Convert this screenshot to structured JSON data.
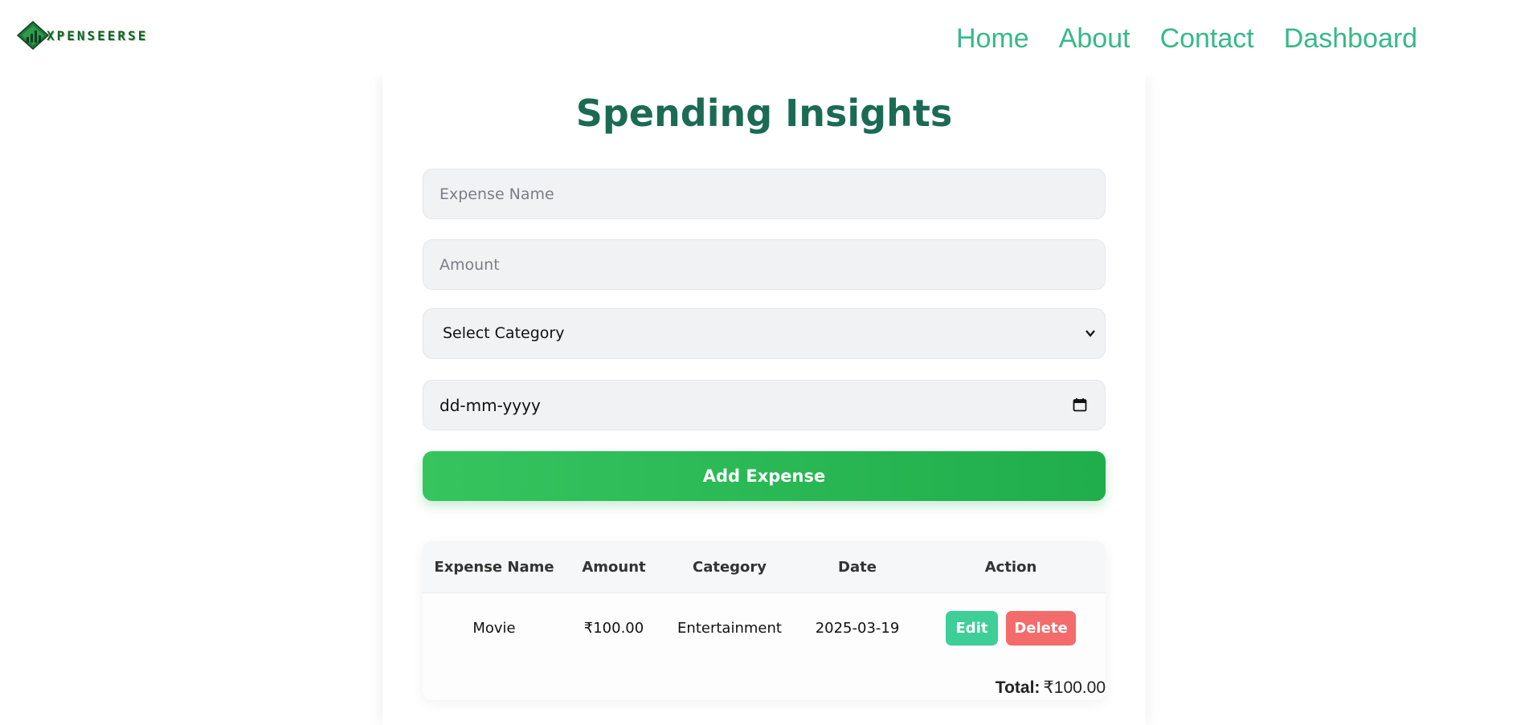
{
  "navbar": {
    "logo_text": "XPENSEERSE",
    "links": [
      "Home",
      "About",
      "Contact",
      "Dashboard"
    ]
  },
  "main": {
    "title": "Spending Insights",
    "form": {
      "expense_name_placeholder": "Expense Name",
      "amount_placeholder": "Amount",
      "category_selected": "Select Category",
      "date_placeholder": "dd-mm-yyyy",
      "add_button": "Add Expense"
    },
    "table": {
      "headers": [
        "Expense Name",
        "Amount",
        "Category",
        "Date",
        "Action"
      ],
      "rows": [
        {
          "name": "Movie",
          "amount": "₹100.00",
          "category": "Entertainment",
          "date": "2025-03-19",
          "edit_label": "Edit",
          "delete_label": "Delete"
        }
      ],
      "total_label": "Total:",
      "total_value": "₹100.00"
    }
  },
  "colors": {
    "accent": "#35b98a",
    "title": "#1b6b54",
    "add_button": "#27b553",
    "edit": "#3ecf99",
    "delete": "#f46b6b"
  },
  "icons": [
    "logo-icon",
    "chevron-down-icon",
    "calendar-icon"
  ]
}
